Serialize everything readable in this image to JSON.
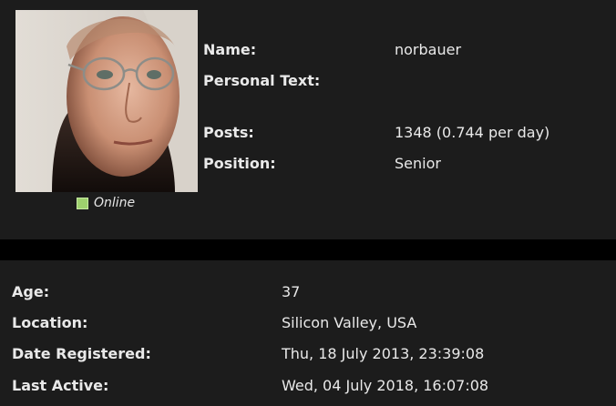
{
  "profile": {
    "online_status": "Online",
    "name_label": "Name:",
    "name_value": "norbauer",
    "personal_text_label": "Personal Text:",
    "personal_text_value": "",
    "posts_label": "Posts:",
    "posts_value": "1348 (0.744 per day)",
    "position_label": "Position:",
    "position_value": "Senior"
  },
  "details": {
    "age_label": "Age:",
    "age_value": "37",
    "location_label": "Location:",
    "location_value": "Silicon Valley, USA",
    "registered_label": "Date Registered:",
    "registered_value": "Thu, 18 July 2013, 23:39:08",
    "last_active_label": "Last Active:",
    "last_active_value": "Wed, 04 July 2018, 16:07:08"
  },
  "colors": {
    "panel_bg": "#1c1c1c",
    "page_bg": "#000000",
    "online_green": "#9ed06e",
    "text": "#e9e9e9"
  }
}
